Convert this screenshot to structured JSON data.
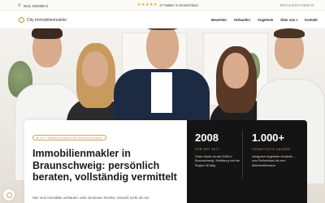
{
  "topbar": {
    "phone": "0531 2028960-0",
    "rating_text": "47 Makler in Deutschland",
    "city": "BRAUNSCHWEIG",
    "stars": 5
  },
  "nav": {
    "logo": "City Immobilienmakler",
    "items": [
      "Bewerten",
      "Verkaufen",
      "Angebote",
      "Über uns",
      "Kontakt"
    ]
  },
  "hero": {
    "tag": "CITY IMMOBILIENMAKLER BRAUNSCHWEIG",
    "headline": "Immobilienmakler in Braunschweig: persönlich beraten, vollständig vermittelt",
    "subtext": "Wer eine Immobilie verkaufen oder vermieten möchte, braucht mehr als ein"
  },
  "stats": [
    {
      "num": "2008",
      "label": "VOR ORT SEIT",
      "desc": "Oliver Martin ist seit 2008 in Braunschweig, Wolfsburg und der Region 38 tätig."
    },
    {
      "num": "1.000+",
      "label": "VERMITTELTE HÄUSER",
      "desc": "erfolgreich begleitete Verkäufe – vom Reihenhaus bis zum Mehrfamilienhaus"
    }
  ],
  "colors": {
    "accent": "#c9a65a",
    "dark": "#141414"
  }
}
